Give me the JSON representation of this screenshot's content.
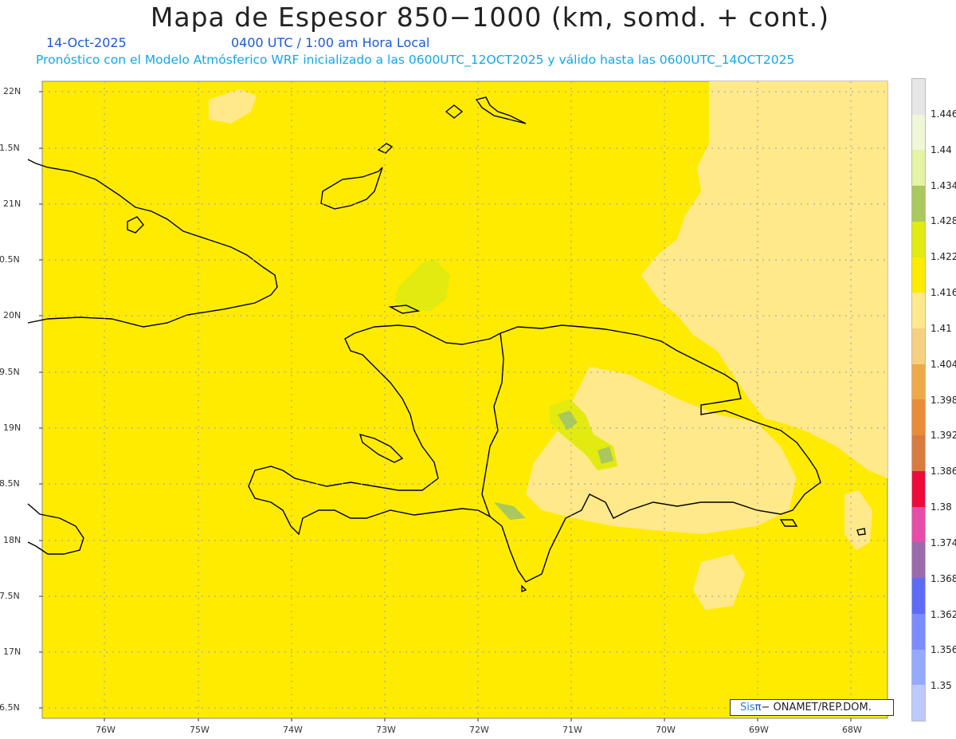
{
  "header": {
    "title": "Mapa de Espesor 850−1000 (km, somd. + cont.)",
    "date": "14-Oct-2025",
    "time": "0400 UTC / 1:00 am Hora Local",
    "description": "Pronóstico con el Modelo Atmósferico WRF inicializado a las 0600UTC_12OCT2025 y válido hasta las  0600UTC_14OCT2025"
  },
  "map": {
    "lat_labels": [
      "22N",
      "21.5N",
      "21N",
      "20.5N",
      "20N",
      "19.5N",
      "19N",
      "18.5N",
      "18N",
      "17.5N",
      "17N",
      "16.5N"
    ],
    "lon_labels": [
      "76W",
      "75W",
      "74W",
      "73W",
      "72W",
      "71W",
      "70W",
      "69W",
      "68W"
    ],
    "background_color": "#ffeb00"
  },
  "legend": {
    "levels": [
      "1.446",
      "1.44",
      "1.434",
      "1.428",
      "1.422",
      "1.416",
      "1.41",
      "1.404",
      "1.398",
      "1.392",
      "1.386",
      "1.38",
      "1.374",
      "1.368",
      "1.362",
      "1.356",
      "1.35"
    ],
    "colors": [
      "#e6e6e6",
      "#f0f6d8",
      "#e4f3a4",
      "#a9c85e",
      "#e2ea10",
      "#ffeb00",
      "#ffe98a",
      "#f6d080",
      "#eeaa48",
      "#e88c38",
      "#d87c3e",
      "#ee0a3a",
      "#e44ea8",
      "#9a6aac",
      "#5c6cf6",
      "#7a8cfe",
      "#94aafe",
      "#bccaff"
    ]
  },
  "credit": {
    "brand": "Sis",
    "pi": "π",
    "org": "− ONAMET/REP.DOM."
  }
}
